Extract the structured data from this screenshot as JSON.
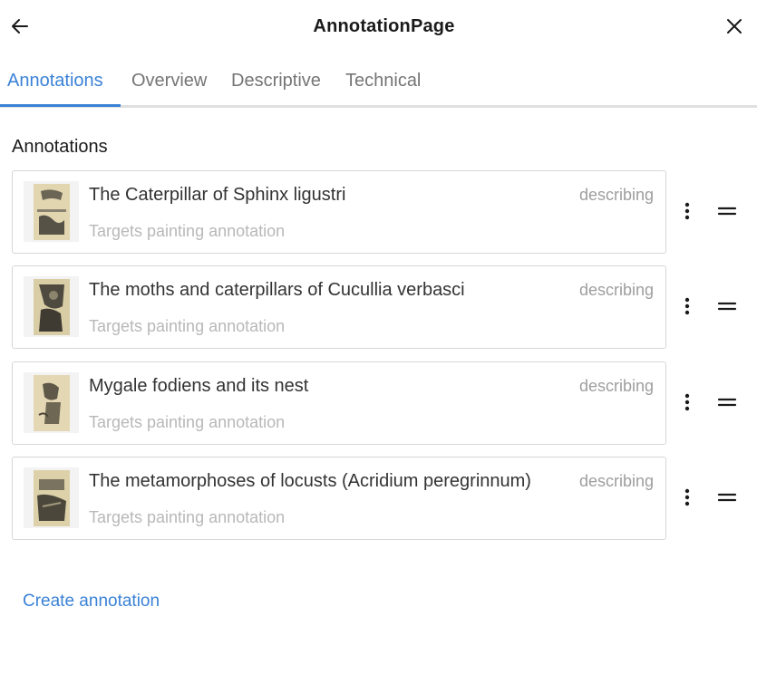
{
  "header": {
    "title": "AnnotationPage",
    "back_icon": "arrow-left-icon",
    "close_icon": "close-icon"
  },
  "tabs": [
    {
      "label": "Annotations",
      "active": true
    },
    {
      "label": "Overview",
      "active": false
    },
    {
      "label": "Descriptive",
      "active": false
    },
    {
      "label": "Technical",
      "active": false
    }
  ],
  "section": {
    "title": "Annotations"
  },
  "annotations": [
    {
      "label": "The Caterpillar of Sphinx ligustri",
      "target": "Targets painting annotation",
      "motivation": "describing"
    },
    {
      "label": "The moths and caterpillars of Cucullia verbasci",
      "target": "Targets painting annotation",
      "motivation": "describing"
    },
    {
      "label": "Mygale fodiens and its nest",
      "target": "Targets painting annotation",
      "motivation": "describing"
    },
    {
      "label": "The metamorphoses of locusts (Acridium peregrinnum)",
      "target": "Targets painting annotation",
      "motivation": "describing"
    }
  ],
  "actions": {
    "create_label": "Create annotation"
  },
  "colors": {
    "accent": "#3b82d6",
    "muted_text": "#b8b8b8",
    "border": "#d6d6d6"
  }
}
